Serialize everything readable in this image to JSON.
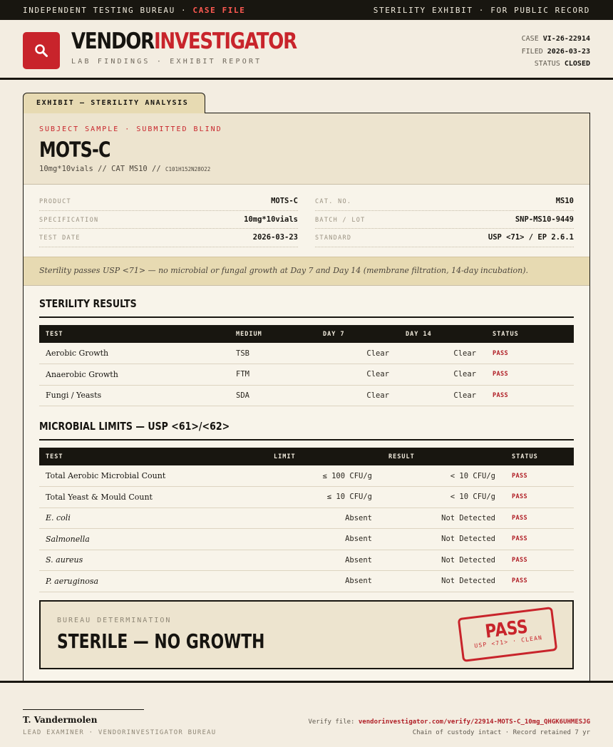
{
  "topbar": {
    "left": "INDEPENDENT TESTING BUREAU ·",
    "left_accent": "CASE FILE",
    "right": "STERILITY EXHIBIT · FOR PUBLIC RECORD"
  },
  "brand": {
    "name_part1": "VENDOR",
    "name_part2": "INVESTIGATOR",
    "subtitle": "LAB FINDINGS · EXHIBIT REPORT",
    "logo_icon": "magnifier-icon",
    "accent_color": "#c8242b"
  },
  "case_meta": {
    "case_label": "CASE",
    "case_value": "VI-26-22914",
    "filed_label": "FILED",
    "filed_value": "2026-03-23",
    "status_label": "STATUS",
    "status_value": "CLOSED"
  },
  "exhibit_tab": "EXHIBIT — STERILITY ANALYSIS",
  "subject": {
    "kicker": "SUBJECT SAMPLE · SUBMITTED BLIND",
    "name": "MOTS-C",
    "line": "10mg*10vials  //  CAT MS10  //",
    "formula": "C101H152N28O22"
  },
  "info": {
    "left": [
      {
        "label": "PRODUCT",
        "value": "MOTS-C"
      },
      {
        "label": "SPECIFICATION",
        "value": "10mg*10vials"
      },
      {
        "label": "TEST DATE",
        "value": "2026-03-23"
      }
    ],
    "right": [
      {
        "label": "CAT. NO.",
        "value": "MS10"
      },
      {
        "label": "BATCH / LOT",
        "value": "SNP-MS10-9449"
      },
      {
        "label": "STANDARD",
        "value": "USP <71> / EP 2.6.1"
      }
    ]
  },
  "summary_note": "Sterility passes USP <71> — no microbial or fungal growth at Day 7 and Day 14 (membrane filtration, 14-day incubation).",
  "sterility": {
    "title": "STERILITY RESULTS",
    "headers": [
      "TEST",
      "MEDIUM",
      "DAY 7",
      "DAY 14",
      "STATUS"
    ],
    "rows": [
      {
        "test": "Aerobic Growth",
        "medium": "TSB",
        "day7": "Clear",
        "day14": "Clear",
        "status": "PASS"
      },
      {
        "test": "Anaerobic Growth",
        "medium": "FTM",
        "day7": "Clear",
        "day14": "Clear",
        "status": "PASS"
      },
      {
        "test": "Fungi / Yeasts",
        "medium": "SDA",
        "day7": "Clear",
        "day14": "Clear",
        "status": "PASS"
      }
    ]
  },
  "microbial": {
    "title": "MICROBIAL LIMITS — USP <61>/<62>",
    "headers": [
      "TEST",
      "LIMIT",
      "RESULT",
      "STATUS"
    ],
    "rows": [
      {
        "test": "Total Aerobic Microbial Count",
        "limit": "≤ 100 CFU/g",
        "result": "< 10 CFU/g",
        "status": "PASS"
      },
      {
        "test": "Total Yeast & Mould Count",
        "limit": "≤ 10 CFU/g",
        "result": "< 10 CFU/g",
        "status": "PASS"
      },
      {
        "test": "E. coli",
        "limit": "Absent",
        "result": "Not Detected",
        "status": "PASS"
      },
      {
        "test": "Salmonella",
        "limit": "Absent",
        "result": "Not Detected",
        "status": "PASS"
      },
      {
        "test": "S. aureus",
        "limit": "Absent",
        "result": "Not Detected",
        "status": "PASS"
      },
      {
        "test": "P. aeruginosa",
        "limit": "Absent",
        "result": "Not Detected",
        "status": "PASS"
      }
    ]
  },
  "determination": {
    "kicker": "BUREAU DETERMINATION",
    "verdict": "STERILE — NO GROWTH",
    "stamp_big": "PASS",
    "stamp_small": "USP <71> · CLEAN"
  },
  "footer": {
    "signer_name": "T. Vandermolen",
    "signer_role": "LEAD EXAMINER · VENDORINVESTIGATOR BUREAU",
    "verify_label": "Verify file:",
    "verify_link": "vendorinvestigator.com/verify/22914-MOTS-C_10mg_QHGK6UHMESJG",
    "custody": "Chain of custody intact · Record retained 7 yr"
  }
}
